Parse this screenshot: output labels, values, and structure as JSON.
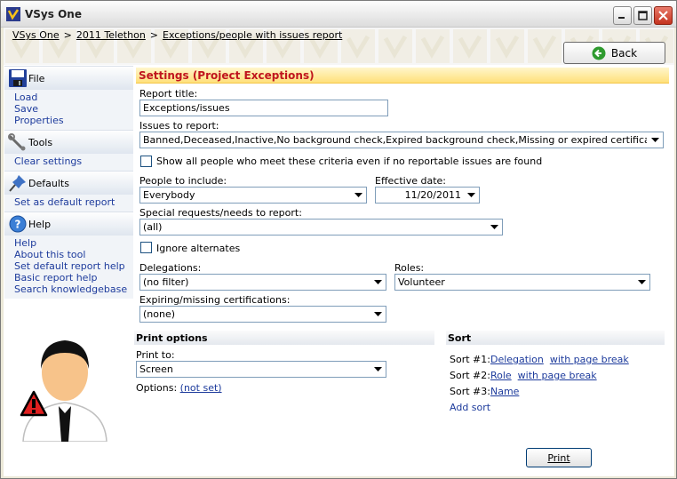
{
  "window": {
    "title": "VSys One"
  },
  "breadcrumb": [
    {
      "label": "VSys One"
    },
    {
      "label": "2011 Telethon"
    },
    {
      "label": "Exceptions/people with issues report"
    }
  ],
  "breadcrumb_sep": ">",
  "toolbar": {
    "back_label": "Back"
  },
  "sidebar": {
    "file": {
      "label": "File",
      "items": [
        "Load",
        "Save",
        "Properties"
      ]
    },
    "tools": {
      "label": "Tools",
      "items": [
        "Clear settings"
      ]
    },
    "defaults": {
      "label": "Defaults",
      "items": [
        "Set as default report"
      ]
    },
    "help": {
      "label": "Help",
      "items": [
        "Help",
        "About this tool",
        "Set default report help",
        "Basic report help",
        "Search knowledgebase"
      ]
    }
  },
  "settings": {
    "header": "Settings (Project Exceptions)",
    "report_title_label": "Report title:",
    "report_title_value": "Exceptions/issues",
    "issues_label": "Issues to report:",
    "issues_value": "Banned,Deceased,Inactive,No background check,Expired background check,Missing or expired certifications,Non-appr",
    "show_all_label": "Show all people who meet these criteria even if no reportable issues are found",
    "people_label": "People to include:",
    "people_value": "Everybody",
    "effective_label": "Effective date:",
    "effective_value": "11/20/2011",
    "special_label": "Special requests/needs to report:",
    "special_value": "(all)",
    "ignore_alt_label": "Ignore alternates",
    "delegations_label": "Delegations:",
    "delegations_value": "(no filter)",
    "roles_label": "Roles:",
    "roles_value": "Volunteer",
    "certs_label": "Expiring/missing certifications:",
    "certs_value": "(none)"
  },
  "print_options": {
    "header": "Print options",
    "print_to_label": "Print to:",
    "print_to_value": "Screen",
    "options_label": "Options:",
    "options_value": "(not set)"
  },
  "sort": {
    "header": "Sort",
    "rows": [
      {
        "label": "Sort #1:",
        "field": "Delegation",
        "page_break": "with page break"
      },
      {
        "label": "Sort #2:",
        "field": "Role",
        "page_break": "with page break"
      },
      {
        "label": "Sort #3:",
        "field": "Name"
      }
    ],
    "add_label": "Add sort"
  },
  "print_label": "Print",
  "colors": {
    "accent_header": "#c0161e",
    "link": "#1d3b9c",
    "header_bg": "#ffe07a"
  },
  "icons": [
    "app-logo-icon",
    "minimize-icon",
    "maximize-icon",
    "close-icon",
    "back-arrow-icon",
    "floppy-disk-icon",
    "wrench-icon",
    "pushpin-icon",
    "help-icon",
    "dropdown-arrow-icon",
    "warning-person-icon"
  ]
}
